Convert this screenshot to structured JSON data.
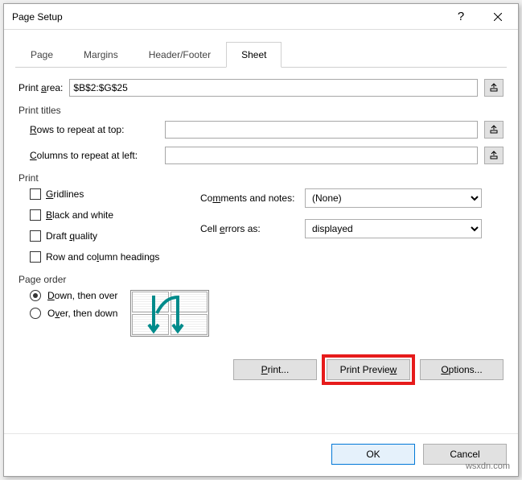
{
  "window": {
    "title": "Page Setup",
    "help_tooltip": "?",
    "close_tooltip": "Close"
  },
  "tabs": {
    "page": "Page",
    "margins": "Margins",
    "header_footer": "Header/Footer",
    "sheet": "Sheet"
  },
  "print_area": {
    "label": "Print area:",
    "value": "$B$2:$G$25"
  },
  "print_titles": {
    "legend": "Print titles",
    "rows_label": "Rows to repeat at top:",
    "rows_value": "",
    "cols_label": "Columns to repeat at left:",
    "cols_value": ""
  },
  "print": {
    "legend": "Print",
    "gridlines": "Gridlines",
    "black_white": "Black and white",
    "draft": "Draft quality",
    "row_col_headings": "Row and column headings",
    "comments_label": "Comments and notes:",
    "comments_value": "(None)",
    "cell_errors_label": "Cell errors as:",
    "cell_errors_value": "displayed"
  },
  "page_order": {
    "legend": "Page order",
    "down_then_over": "Down, then over",
    "over_then_down": "Over, then down"
  },
  "buttons": {
    "print": "Print...",
    "print_preview": "Print Preview",
    "options": "Options...",
    "ok": "OK",
    "cancel": "Cancel"
  },
  "watermark": "wsxdn.com"
}
